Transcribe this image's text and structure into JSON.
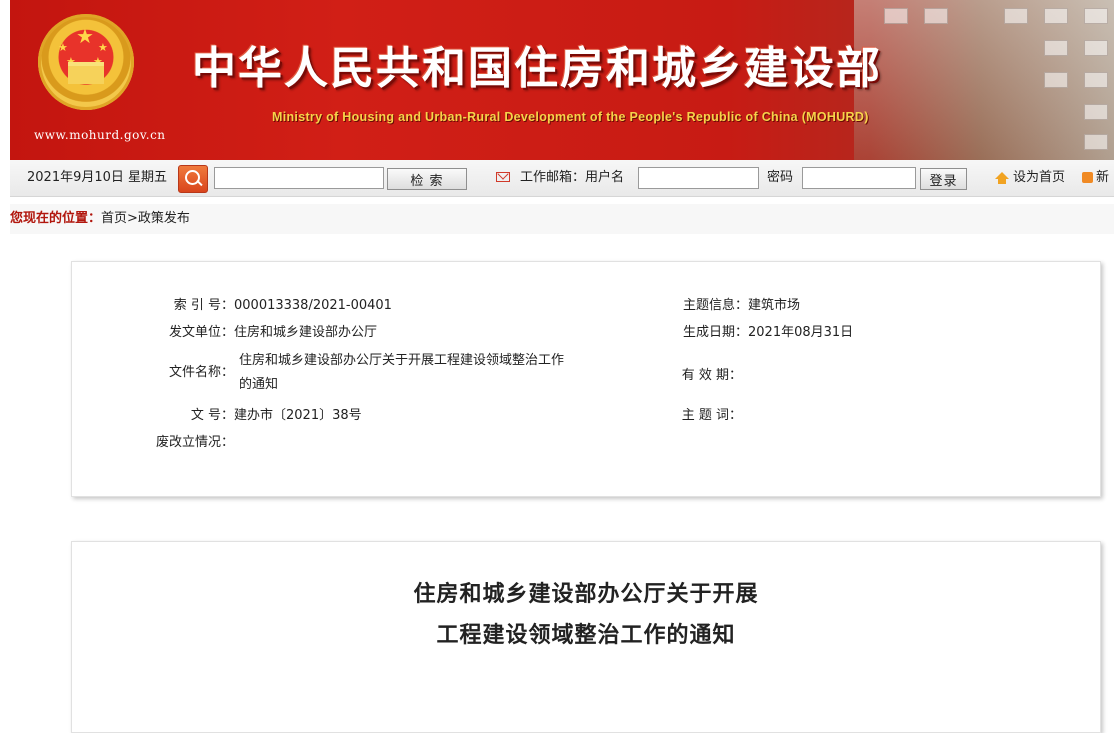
{
  "banner": {
    "title_cn": "中华人民共和国住房和城乡建设部",
    "title_en": "Ministry of Housing and Urban-Rural Development of the People's Republic of China (MOHURD)",
    "site_url": "www.mohurd.gov.cn",
    "colors": {
      "banner_red": "#c3150f",
      "title_en_gold": "#f7d34a"
    }
  },
  "toolbar": {
    "date_text": "2021年9月10日 星期五",
    "search_input_value": "",
    "search_button_label": "检    索",
    "mail_label": "工作邮箱：用户名",
    "username_value": "",
    "password_label": "密码",
    "password_value": "",
    "login_button_label": "登录",
    "set_home_label": "设为首页",
    "new_label": "新",
    "icons": [
      "search-icon",
      "mail-icon",
      "home-icon",
      "rss-icon"
    ]
  },
  "breadcrumb": {
    "lead": "您现在的位置：",
    "path": "首页>政策发布"
  },
  "info": {
    "index_label": "索 引 号：",
    "index_value": "000013338/2021-00401",
    "issuer_label": "发文单位：",
    "issuer_value": "住房和城乡建设部办公厅",
    "filename_label": "文件名称：",
    "filename_value_line1": "住房和城乡建设部办公厅关于开展工程建设领域整治工作",
    "filename_value_line2": "的通知",
    "docno_label": "文        号：",
    "docno_value": "建办市〔2021〕38号",
    "status_label": "废改立情况：",
    "status_value": "",
    "subject_label": "主题信息：",
    "subject_value": "建筑市场",
    "date_label": "生成日期：",
    "date_value": "2021年08月31日",
    "valid_label": "有 效 期：",
    "valid_value": "",
    "keyword_label": "主 题 词：",
    "keyword_value": ""
  },
  "document": {
    "title_line1": "住房和城乡建设部办公厅关于开展",
    "title_line2": "工程建设领域整治工作的通知"
  }
}
